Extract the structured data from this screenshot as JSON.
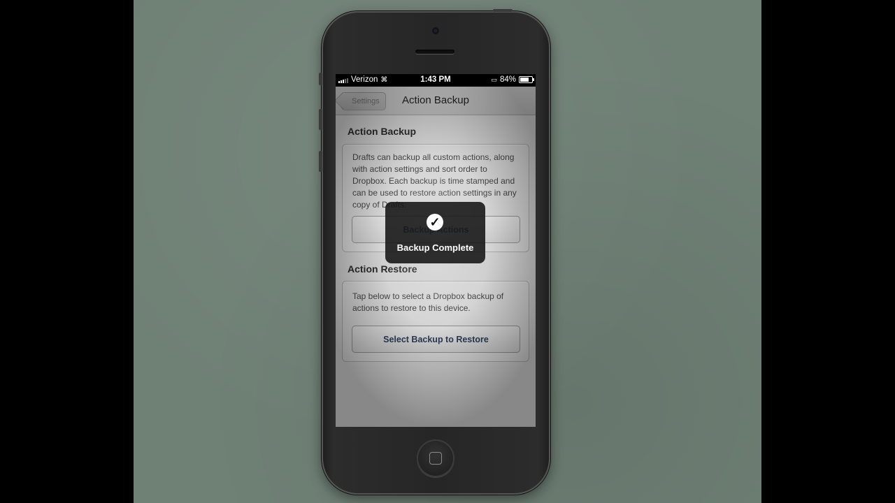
{
  "status_bar": {
    "carrier": "Verizon",
    "time": "1:43 PM",
    "battery": "84%",
    "battery_level": 0.84
  },
  "nav": {
    "back_label": "Settings",
    "title": "Action Backup"
  },
  "backup_section": {
    "title": "Action Backup",
    "description": "Drafts can backup all custom actions, along with action settings and sort order to Dropbox. Each backup is time stamped and can be used to restore action settings in any copy of Drafts.",
    "button_label": "Backup Actions"
  },
  "restore_section": {
    "title": "Action Restore",
    "description": "Tap below to select a Dropbox backup of actions to restore to this device.",
    "button_label": "Select Backup to Restore"
  },
  "hud": {
    "icon": "checkmark-icon",
    "label": "Backup Complete"
  }
}
